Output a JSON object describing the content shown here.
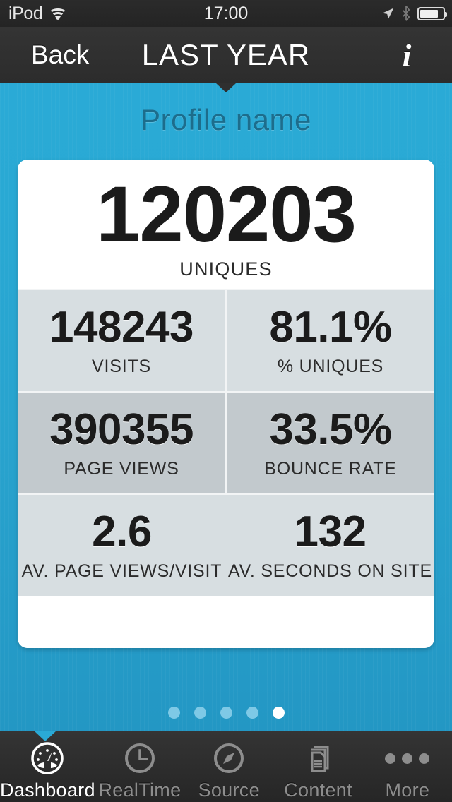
{
  "statusbar": {
    "carrier": "iPod",
    "time": "17:00",
    "wifi_icon": "wifi-icon",
    "location_icon": "location-arrow-icon",
    "bluetooth_icon": "bluetooth-icon",
    "battery_icon": "battery-icon"
  },
  "navbar": {
    "back_label": "Back",
    "title": "LAST YEAR",
    "info_label": "i"
  },
  "header": {
    "profile_name": "Profile name"
  },
  "colors": {
    "accent_blue": "#2aaad6",
    "card_white": "#ffffff",
    "row_light": "#d7dee1",
    "row_dark": "#c2c9cd",
    "bar_dark": "#2c2c2c",
    "active_tab": "#ffffff",
    "inactive_tab": "#8d8d8d"
  },
  "dashboard": {
    "hero": {
      "value": "120203",
      "label": "UNIQUES"
    },
    "rows": [
      {
        "shade": "light",
        "divided": true,
        "cells": [
          {
            "value": "148243",
            "label": "VISITS"
          },
          {
            "value": "81.1%",
            "label": "% UNIQUES"
          }
        ]
      },
      {
        "shade": "dark",
        "divided": true,
        "cells": [
          {
            "value": "390355",
            "label": "PAGE VIEWS"
          },
          {
            "value": "33.5%",
            "label": "BOUNCE RATE"
          }
        ]
      },
      {
        "shade": "light",
        "divided": false,
        "cells": [
          {
            "value": "2.6",
            "label": "AV. PAGE VIEWS/VISIT"
          },
          {
            "value": "132",
            "label": "AV. SECONDS ON SITE"
          }
        ]
      }
    ]
  },
  "pager": {
    "total": 5,
    "active_index": 5
  },
  "tabbar": {
    "active_index": 0,
    "items": [
      {
        "label": "Dashboard",
        "icon": "gauge-icon"
      },
      {
        "label": "RealTime",
        "icon": "clock-icon"
      },
      {
        "label": "Source",
        "icon": "compass-icon"
      },
      {
        "label": "Content",
        "icon": "documents-icon"
      },
      {
        "label": "More",
        "icon": "ellipsis-icon"
      }
    ]
  }
}
